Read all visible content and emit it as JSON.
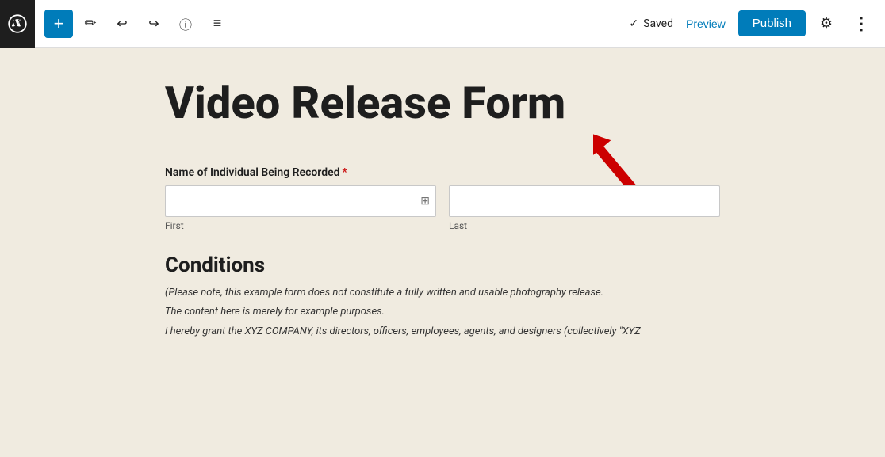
{
  "toolbar": {
    "wp_logo_alt": "WordPress Logo",
    "add_label": "+",
    "save_label": "Saved",
    "preview_label": "Preview",
    "publish_label": "Publish",
    "edit_icon": "✏",
    "undo_icon": "↩",
    "redo_icon": "↪",
    "info_icon": "ⓘ",
    "list_icon": "≡",
    "gear_icon": "⚙",
    "dots_icon": "⋮"
  },
  "page": {
    "title": "Video Release Form",
    "field_label": "Name of Individual Being Recorded",
    "required_star": "*",
    "first_label": "First",
    "last_label": "Last",
    "conditions_heading": "Conditions",
    "conditions_line1": "(Please note, this example form does not constitute a fully written and usable photography release.",
    "conditions_line2": "The content here is merely for example purposes.",
    "conditions_line3": "I hereby grant the XYZ COMPANY, its directors, officers, employees, agents, and designers (collectively \"XYZ"
  }
}
